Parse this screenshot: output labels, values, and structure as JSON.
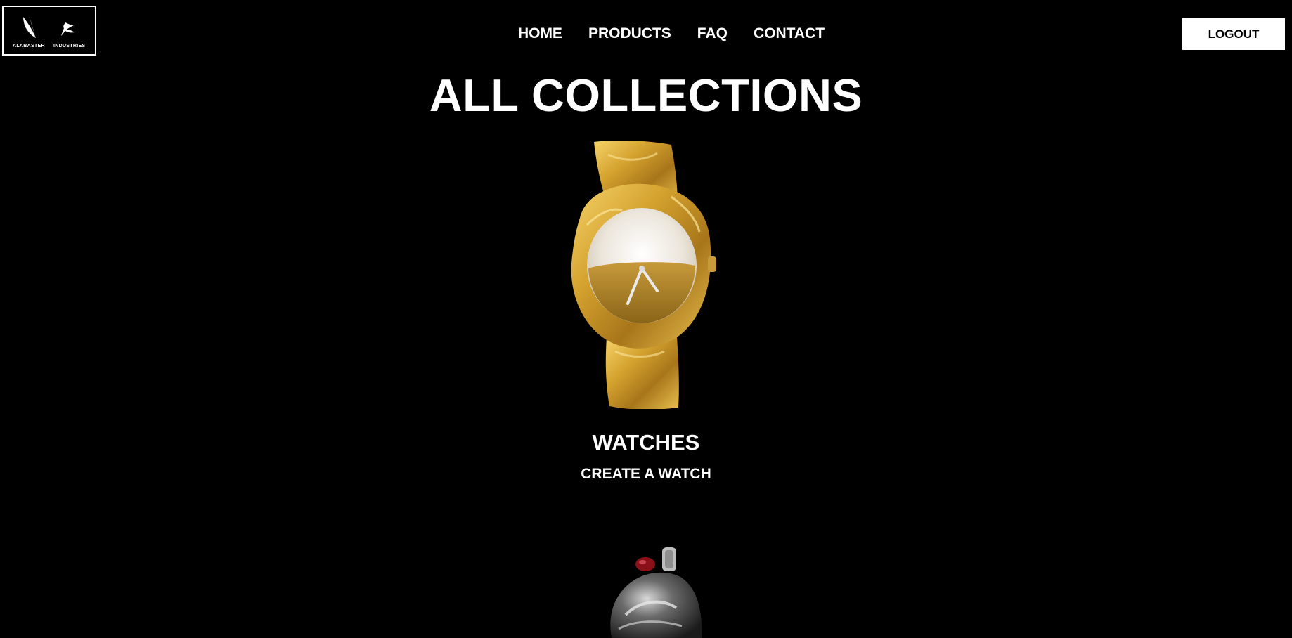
{
  "logo": {
    "left_word": "ALABASTER",
    "right_word": "INDUSTRIES"
  },
  "nav": {
    "items": [
      "HOME",
      "PRODUCTS",
      "FAQ",
      "CONTACT"
    ]
  },
  "header": {
    "logout_label": "LOGOUT"
  },
  "main": {
    "title": "ALL COLLECTIONS",
    "collections": [
      {
        "name": "WATCHES",
        "link_label": "CREATE A WATCH",
        "image_icon": "gold-watch-image"
      },
      {
        "image_icon": "ring-image"
      }
    ]
  },
  "colors": {
    "background": "#000000",
    "text": "#ffffff",
    "button_bg": "#ffffff",
    "button_text": "#000000",
    "gold": "#d4a22e"
  }
}
